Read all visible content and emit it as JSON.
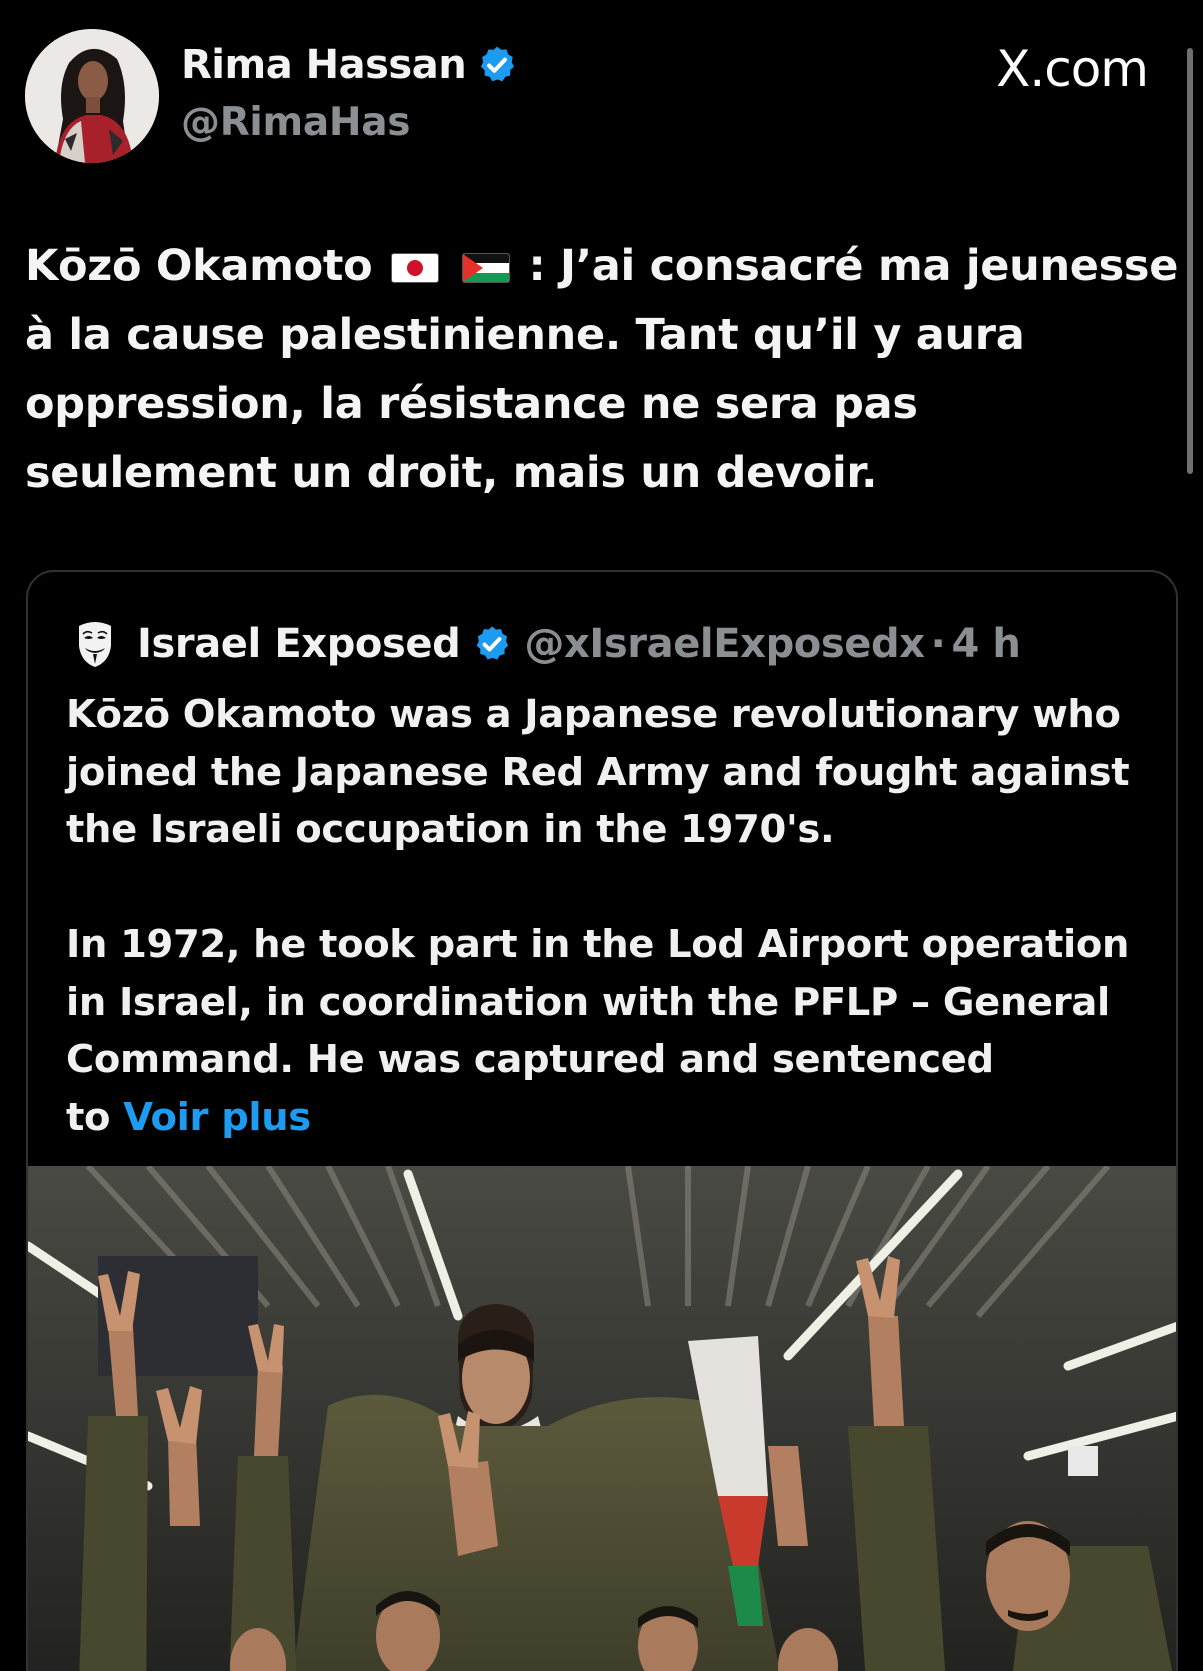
{
  "header": {
    "author_name": "Rima Hassan",
    "author_handle": "@RimaHas",
    "site_label": "X.com",
    "verified_color": "#1d9bf0"
  },
  "tweet": {
    "line1_prefix": "Kōzō Okamoto",
    "flags": [
      "japan-flag",
      "palestine-flag"
    ],
    "line1_suffix": ": J’ai consacré ma jeunesse",
    "line2": "à la cause palestinienne. Tant qu’il y aura",
    "line3": "oppression, la résistance ne sera pas",
    "line4": "seulement un droit, mais un devoir."
  },
  "quote": {
    "avatar_icon": "anonymous-mask-icon",
    "name": "Israel Exposed",
    "handle": "@xIsraelExposedx",
    "separator": "·",
    "time": "4 h",
    "p1_line1": "Kōzō Okamoto was a Japanese revolutionary who",
    "p1_line2": "joined the Japanese Red Army and fought against",
    "p1_line3": "the Israeli occupation in the 1970's.",
    "p2_line1": "In 1972, he took part in the Lod Airport operation",
    "p2_line2": "in Israel, in coordination with the PFLP – General",
    "p2_line3": "Command. He was captured and sentenced",
    "p2_line4_prefix": "to",
    "see_more": "Voir plus",
    "link_color": "#1d9bf0"
  },
  "media": {
    "photo_icon": "crowd-photo"
  }
}
